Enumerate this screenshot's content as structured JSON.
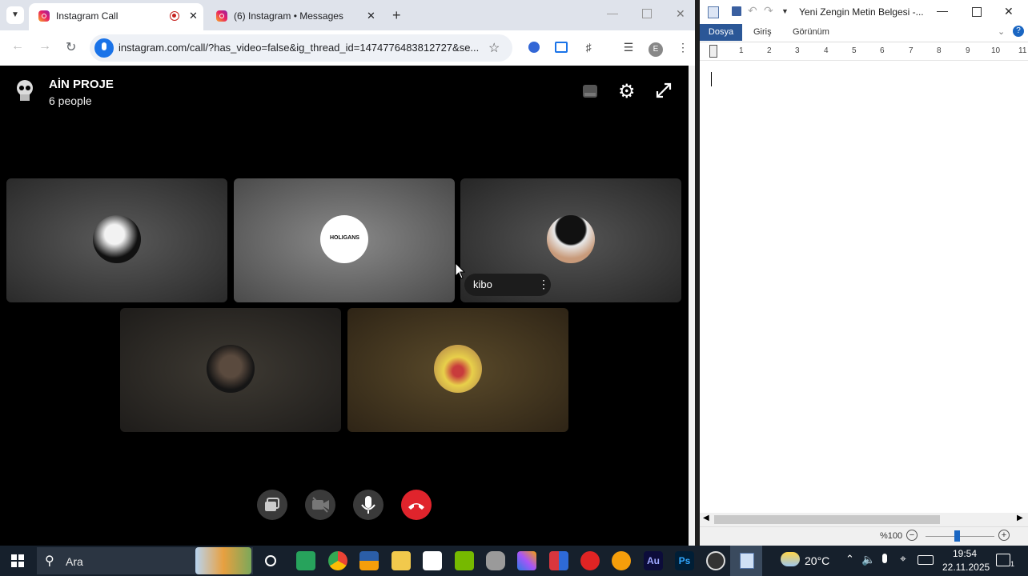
{
  "chrome": {
    "tabs": [
      {
        "title": "Instagram Call",
        "active": true
      },
      {
        "title": "(6) Instagram • Messages",
        "active": false
      }
    ],
    "url": "instagram.com/call/?has_video=false&ig_thread_id=1474776483812727&se..."
  },
  "call": {
    "group_name": "AİN PROJE",
    "group_count": "6 people",
    "tooltip_name": "kibo",
    "tooltip_more": "⋮"
  },
  "wordpad": {
    "title": "Yeni Zengin Metin Belgesi -...",
    "tabs": [
      "Dosya",
      "Giriş",
      "Görünüm"
    ],
    "ruler_marks": [
      "1",
      "2",
      "3",
      "4",
      "5",
      "6",
      "7",
      "8",
      "9",
      "10",
      "11"
    ],
    "zoom_label": "%100",
    "zoom_level_percent": 100
  },
  "taskbar": {
    "search_placeholder": "Ara",
    "temperature": "20°C",
    "time": "19:54",
    "date": "22.11.2025",
    "notifications": "1",
    "app_labels": {
      "au": "Au",
      "ps": "Ps"
    }
  }
}
